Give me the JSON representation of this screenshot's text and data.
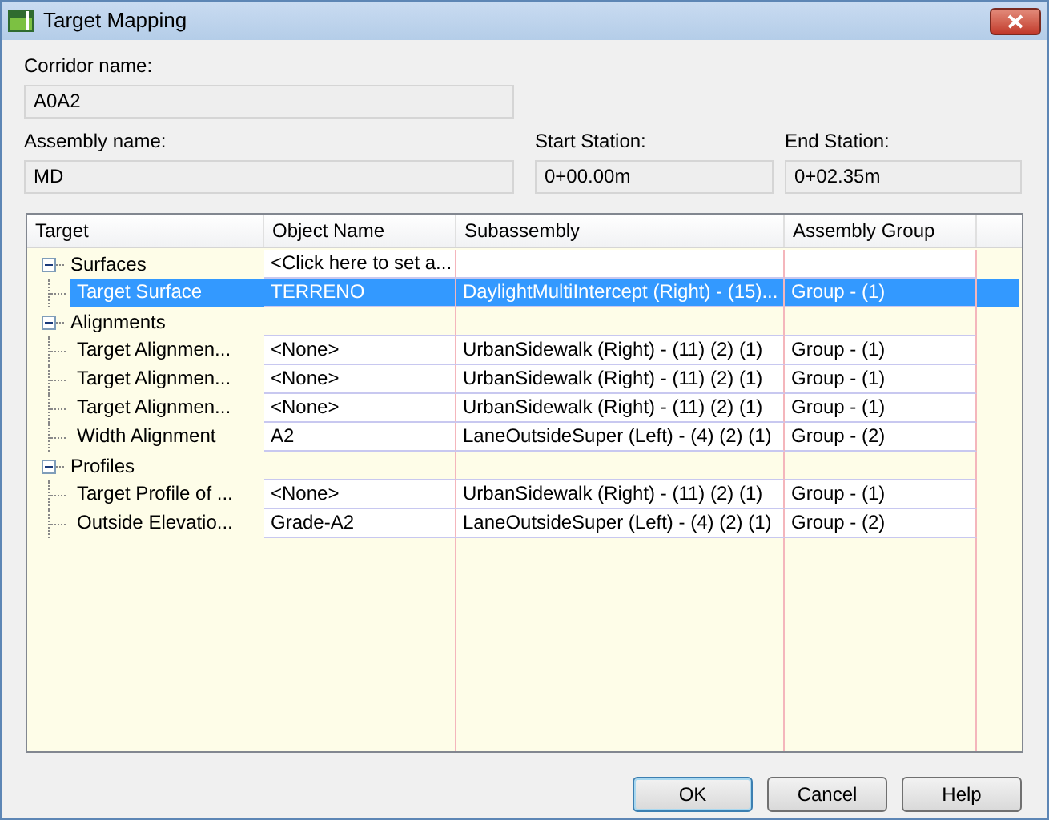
{
  "window": {
    "title": "Target Mapping"
  },
  "corridor": {
    "label": "Corridor name:",
    "value": "A0A2"
  },
  "assembly": {
    "label": "Assembly name:",
    "value": "MD"
  },
  "start_station": {
    "label": "Start Station:",
    "value": "0+00.00m"
  },
  "end_station": {
    "label": "End Station:",
    "value": "0+02.35m"
  },
  "table": {
    "columns": [
      "Target",
      "Object Name",
      "Subassembly",
      "Assembly Group"
    ],
    "groups": [
      {
        "label": "Surfaces",
        "expanded": true,
        "editable": true,
        "object": "<Click here to set a...",
        "children": [
          {
            "target": "Target Surface",
            "object": "TERRENO",
            "subassembly": "DaylightMultiIntercept (Right) - (15)...",
            "group": "Group - (1)",
            "selected": true
          }
        ]
      },
      {
        "label": "Alignments",
        "expanded": true,
        "editable": false,
        "children": [
          {
            "target": "Target Alignmen...",
            "object": "<None>",
            "subassembly": "UrbanSidewalk (Right) - (11) (2) (1)",
            "group": "Group - (1)",
            "selected": false
          },
          {
            "target": "Target Alignmen...",
            "object": "<None>",
            "subassembly": "UrbanSidewalk (Right) - (11) (2) (1)",
            "group": "Group - (1)",
            "selected": false
          },
          {
            "target": "Target Alignmen...",
            "object": "<None>",
            "subassembly": "UrbanSidewalk (Right) - (11) (2) (1)",
            "group": "Group - (1)",
            "selected": false
          },
          {
            "target": "Width Alignment",
            "object": "A2",
            "subassembly": "LaneOutsideSuper (Left) - (4) (2) (1)",
            "group": "Group - (2)",
            "selected": false
          }
        ]
      },
      {
        "label": "Profiles",
        "expanded": true,
        "editable": false,
        "children": [
          {
            "target": "Target Profile of ...",
            "object": "<None>",
            "subassembly": "UrbanSidewalk (Right) - (11) (2) (1)",
            "group": "Group - (1)",
            "selected": false
          },
          {
            "target": "Outside Elevatio...",
            "object": "Grade-A2",
            "subassembly": "LaneOutsideSuper (Left) - (4) (2) (1)",
            "group": "Group - (2)",
            "selected": false
          }
        ]
      }
    ]
  },
  "buttons": [
    {
      "label": "OK",
      "default": true
    },
    {
      "label": "Cancel",
      "default": false
    },
    {
      "label": "Help",
      "default": false
    }
  ]
}
